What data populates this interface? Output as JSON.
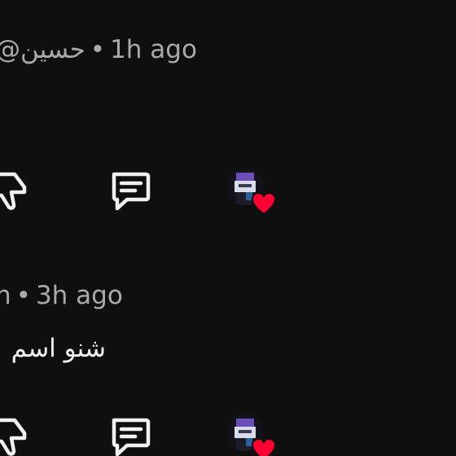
{
  "comments": [
    {
      "author": "@حسين",
      "separator": "•",
      "time": "1h ago",
      "text": ""
    },
    {
      "author": "h",
      "separator": "•",
      "time": "3h ago",
      "text": "شنو اسم"
    }
  ],
  "actions": {
    "dislike_icon": "thumbs-down-icon",
    "reply_icon": "reply-comment-icon",
    "creator_heart_icon": "creator-heart-icon"
  },
  "colors": {
    "background": "#0f0f0f",
    "meta_text": "#aaaaaa",
    "body_text": "#f1f1f1",
    "heart": "#ff0033"
  }
}
